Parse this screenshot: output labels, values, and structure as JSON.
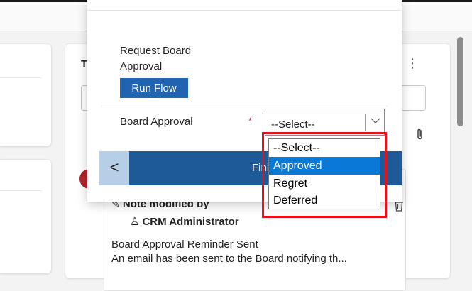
{
  "background": {
    "right_card": {
      "title_fragment": "T",
      "note": {
        "title_prefix": "Note modified by",
        "author": "CRM Administrator",
        "subject": "Board Approval Reminder Sent",
        "body": "An email has been sent to the Board notifying th..."
      }
    }
  },
  "flyout": {
    "stage_label": "Request Board Approval",
    "run_flow_label": "Run Flow",
    "field": {
      "label": "Board Approval",
      "required_marker": "*",
      "current_value": "--Select--"
    },
    "back_label": "<",
    "finish_label": "Finish"
  },
  "dropdown": {
    "options": [
      "--Select--",
      "Approved",
      "Regret",
      "Deferred"
    ],
    "highlighted": "Approved",
    "highlight_color": "#0a78d7",
    "callout_color": "#e0141c"
  },
  "colors": {
    "run_flow": "#1f63b1",
    "nav_bar": "#1e5a98",
    "back_button": "#b6cfe6",
    "avatar": "#b3262d"
  },
  "icons": {
    "more": "more-vertical-icon",
    "attach": "paperclip-icon",
    "delete": "trash-icon",
    "edit": "pencil-icon",
    "person": "person-icon",
    "chevron": "chevron-down-icon"
  }
}
